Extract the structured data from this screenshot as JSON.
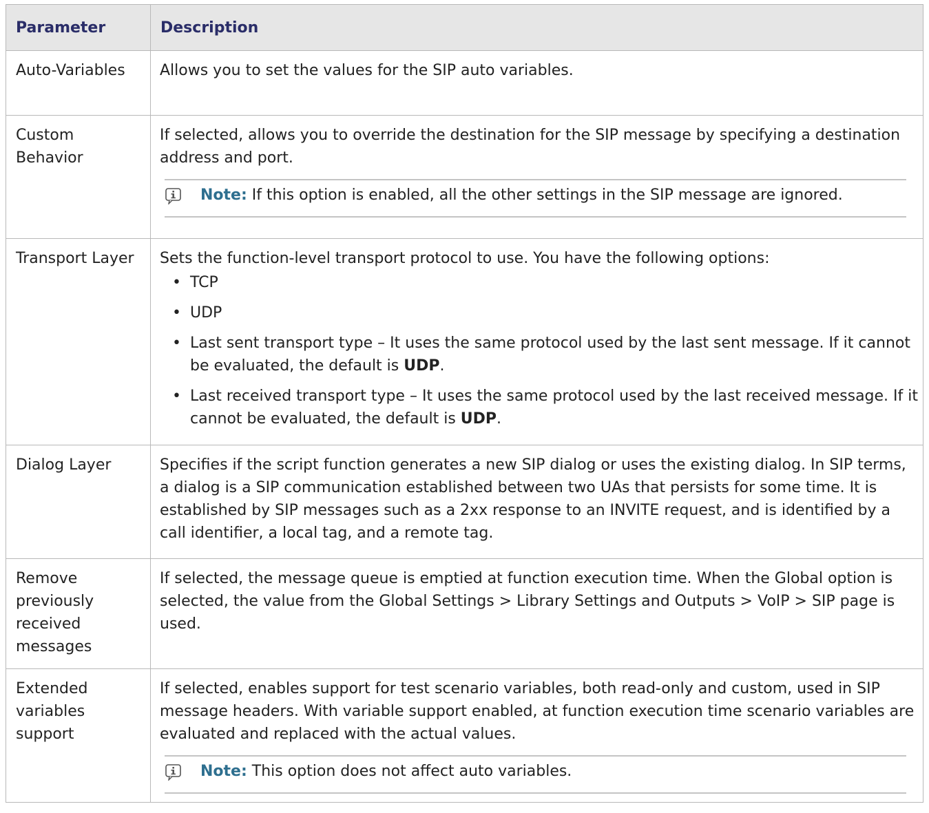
{
  "table": {
    "headers": [
      "Parameter",
      "Description"
    ],
    "rows": [
      {
        "param": "Auto-Variables",
        "desc": "Allows you to set the values for the SIP auto variables."
      },
      {
        "param": "Custom Behavior",
        "desc": "If selected, allows you to override the destination for the SIP message by specifying a destination address and port.",
        "note": {
          "label": "Note:",
          "text": " If this option is enabled, all the other settings in the SIP message are ignored.",
          "icon": "info-icon"
        }
      },
      {
        "param": "Transport Layer",
        "desc": "Sets the function-level transport protocol to use. You have the following options:",
        "options": [
          {
            "text": "TCP",
            "bold": "",
            "tail": ""
          },
          {
            "text": "UDP",
            "bold": "",
            "tail": ""
          },
          {
            "text": "Last sent transport type – It uses the same protocol used by the last sent message. If it cannot be evaluated, the default is ",
            "bold": "UDP",
            "tail": "."
          },
          {
            "text": "Last received transport type – It uses the same protocol used by the last received message. If it cannot be evaluated, the default is ",
            "bold": "UDP",
            "tail": "."
          }
        ]
      },
      {
        "param": "Dialog Layer",
        "desc": "Specifies if the script function generates a new SIP dialog or uses the existing dialog. In SIP terms, a dialog is a SIP communication established between two UAs that persists for some time. It is established by SIP messages such as a 2xx response to an INVITE request, and is identified by a call identifier, a local tag, and a remote tag."
      },
      {
        "param": "Remove previously received messages",
        "desc": "If selected, the message queue is emptied at function execution time. When the Global option is selected, the value from the Global Settings > Library Settings and Outputs > VoIP > SIP page is used."
      },
      {
        "param": "Extended variables support",
        "desc": "If selected, enables support for test scenario variables, both read-only and custom, used in SIP message headers. With variable support enabled, at function execution time scenario variables are evaluated and replaced with the actual values.",
        "note": {
          "label": "Note:",
          "text": " This option does not affect auto variables.",
          "icon": "info-icon"
        }
      }
    ]
  }
}
